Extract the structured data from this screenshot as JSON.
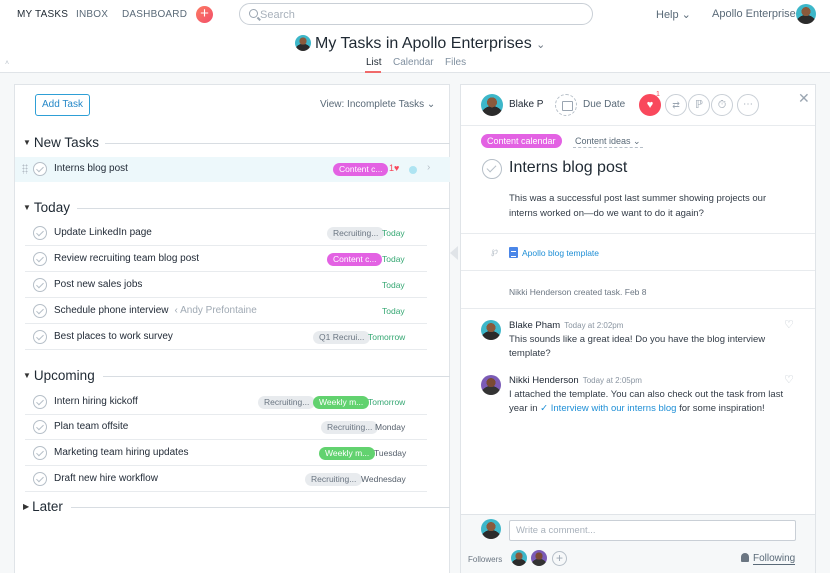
{
  "topbar": {
    "nav": [
      "MY TASKS",
      "INBOX",
      "DASHBOARD"
    ],
    "quick_add": "+",
    "search_placeholder": "Search",
    "help": "Help ⌄",
    "org": "Apollo Enterprise..."
  },
  "title": {
    "text": "My Tasks in Apollo Enterprises",
    "chevron": "⌄",
    "tabs": [
      "List",
      "Calendar",
      "Files"
    ],
    "active_tab": "List"
  },
  "list": {
    "add_task": "Add Task",
    "view": "View: Incomplete Tasks ⌄",
    "sections": [
      {
        "name": "New Tasks",
        "tasks": [
          {
            "name": "Interns blog post",
            "tags": [
              {
                "label": "Content c...",
                "color": "pink"
              }
            ],
            "likes": "1♥",
            "due": ""
          }
        ]
      },
      {
        "name": "Today",
        "tasks": [
          {
            "name": "Update LinkedIn page",
            "tags": [
              {
                "label": "Recruiting...",
                "color": "gray"
              }
            ],
            "due": "Today"
          },
          {
            "name": "Review recruiting team blog post",
            "tags": [
              {
                "label": "Content c...",
                "color": "pink"
              }
            ],
            "due": "Today"
          },
          {
            "name": "Post new sales jobs",
            "tags": [],
            "due": "Today"
          },
          {
            "name": "Schedule phone interview",
            "assignee": "‹ Andy Prefontaine",
            "tags": [],
            "due": "Today"
          },
          {
            "name": "Best places to work survey",
            "tags": [
              {
                "label": "Q1 Recrui...",
                "color": "gray"
              }
            ],
            "due": "Tomorrow"
          }
        ]
      },
      {
        "name": "Upcoming",
        "tasks": [
          {
            "name": "Intern hiring kickoff",
            "tags": [
              {
                "label": "Recruiting...",
                "color": "gray"
              },
              {
                "label": "Weekly m...",
                "color": "green"
              }
            ],
            "due": "Tomorrow"
          },
          {
            "name": "Plan team offsite",
            "tags": [
              {
                "label": "Recruiting...",
                "color": "gray"
              }
            ],
            "due": "Monday"
          },
          {
            "name": "Marketing team hiring updates",
            "tags": [
              {
                "label": "Weekly m...",
                "color": "green"
              }
            ],
            "due": "Tuesday"
          },
          {
            "name": "Draft new hire workflow",
            "tags": [
              {
                "label": "Recruiting...",
                "color": "gray"
              }
            ],
            "due": "Wednesday"
          }
        ]
      },
      {
        "name": "Later",
        "tasks": []
      }
    ]
  },
  "detail": {
    "assignee": "Blake P",
    "due_date": "Due Date",
    "heart_count": "1",
    "tag": "Content calendar",
    "section_select": "Content ideas ⌄",
    "title": "Interns blog post",
    "description": "This was a successful post last summer showing projects our interns worked on—do we want to do it again?",
    "attachment": "Apollo blog template",
    "activity": "Nikki Henderson created task.   Feb 8",
    "comments": [
      {
        "author": "Blake Pham",
        "time": "Today at 2:02pm",
        "body": "This sounds like a great idea! Do you have the blog interview template?"
      },
      {
        "author": "Nikki Henderson",
        "time": "Today at 2:05pm",
        "body_prefix": "I attached the template. You can also check out the task from last year in ",
        "link": "✓ Interview with our interns blog",
        "body_suffix": " for some inspiration!"
      }
    ],
    "comment_placeholder": "Write a comment...",
    "followers_label": "Followers",
    "following": "Following"
  }
}
